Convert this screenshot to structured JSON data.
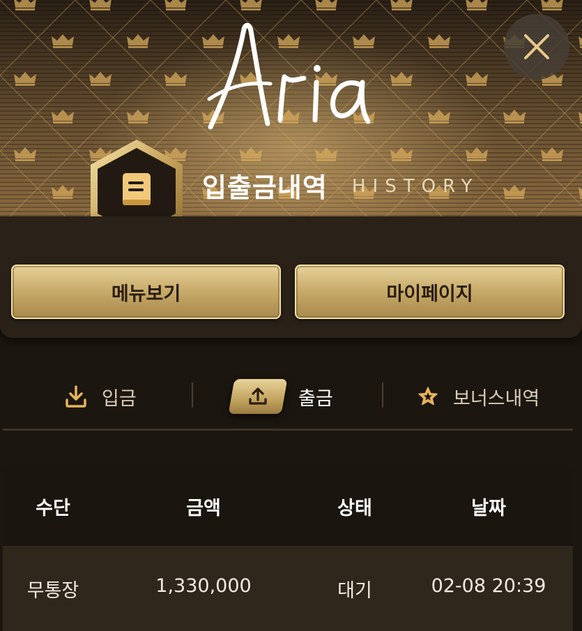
{
  "header": {
    "logo_text": "Aria",
    "title": "입출금내역",
    "subtitle": "HISTORY",
    "close_icon": "close-icon",
    "badge_icon": "ledger-book-icon"
  },
  "menu": {
    "menu_view": "메뉴보기",
    "my_page": "마이페이지"
  },
  "tabs": [
    {
      "label": "입금",
      "icon": "download-icon",
      "active": false
    },
    {
      "label": "출금",
      "icon": "upload-icon",
      "active": true
    },
    {
      "label": "보너스내역",
      "icon": "star-icon",
      "active": false
    }
  ],
  "table": {
    "columns": [
      "수단",
      "금액",
      "상태",
      "날짜"
    ],
    "rows": [
      {
        "method": "무통장",
        "amount": "1,330,000",
        "status": "대기",
        "date": "02-08 20:39"
      }
    ]
  },
  "colors": {
    "gold": "#c9ad6c",
    "gold_light": "#f1e0a6",
    "background": "#1c1610",
    "icon_gold": "#e7b45a"
  }
}
